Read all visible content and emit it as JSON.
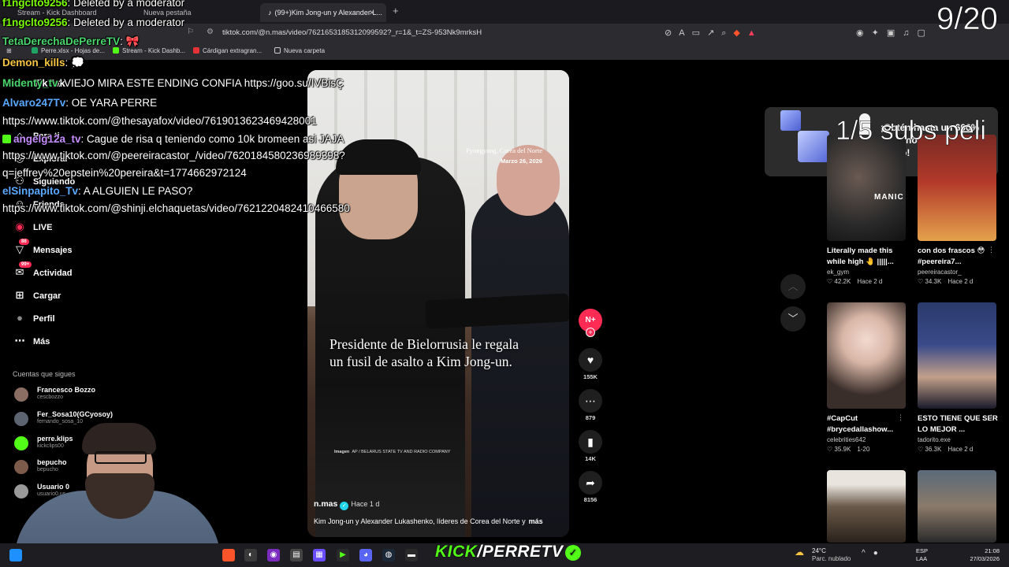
{
  "browser": {
    "tabs": [
      {
        "label": "Stream - Kick Dashboard"
      },
      {
        "label": "Nueva pestaña"
      },
      {
        "label": "(99+)Kim Jong-un y Alexander L..."
      }
    ],
    "url": "tiktok.com/@n.mas/video/7621653185312099592?_r=1&_t=ZS-953Nk9mrksH",
    "bookmarks": [
      {
        "label": "Perre.xlsx - Hojas de...",
        "color": "#1fa463"
      },
      {
        "label": "Stream - Kick Dashb...",
        "color": "#53fc18"
      },
      {
        "label": "Cárdigan extragran...",
        "color": "#e53238"
      },
      {
        "label": "Nueva carpeta",
        "color": "#cccccc"
      }
    ]
  },
  "overlays": {
    "counter": "9/20",
    "subs": "1/5 subs peli"
  },
  "chat": [
    {
      "user": "f1ngclto9256",
      "user_color": "#7cfc00",
      "text": ": Deleted by a moderator"
    },
    {
      "user": "f1ngclto9256",
      "user_color": "#7cfc00",
      "text": ": Deleted by a moderator"
    },
    {
      "user": "TetaDerechaDePerreTV",
      "user_color": "#4ad66d",
      "text": ": 🎀"
    },
    {
      "user": "Demon_kills",
      "user_color": "#f5c542",
      "text": ": 💭"
    },
    {
      "user": "Midenty_tv",
      "user_color": "#4ad66d",
      "text": ": VIEJO MIRA ESTE ENDING CONFIA https://goo.su/IVBisÇ"
    },
    {
      "user": "Alvaro247Tv",
      "user_color": "#5aa9ff",
      "text": ": OE YARA PERRE"
    },
    {
      "user": "",
      "user_color": "#ffffff",
      "text": "https://www.tiktok.com/@thesayafox/video/7619013623469428001"
    },
    {
      "user": "angelg12a_tv",
      "user_color": "#c58cff",
      "text": ": Cague de risa q teniendo como 10k bromeen asi JAJA"
    },
    {
      "user": "",
      "user_color": "#ffffff",
      "text": "https://www.tiktok.com/@peereiracastor_/video/7620184580236989398?"
    },
    {
      "user": "",
      "user_color": "#ffffff",
      "text": "q=jeffrey%20epstein%20pereira&t=1774662972124"
    },
    {
      "user": "elSinpapito_Tv",
      "user_color": "#5aa9ff",
      "text": ": A ALGUIEN LE PASO?"
    },
    {
      "user": "",
      "user_color": "#ffffff",
      "text": "https://www.tiktok.com/@shinji.elchaquetas/video/7621220482410466580"
    }
  ],
  "sidebar": {
    "items": [
      {
        "label": "TikTok",
        "icon": "tiktok-logo"
      },
      {
        "label": "Para ti",
        "icon": "home-icon"
      },
      {
        "label": "Explorar",
        "icon": "compass-icon"
      },
      {
        "label": "Siguiendo",
        "icon": "following-icon"
      },
      {
        "label": "Friends",
        "icon": "friends-icon"
      },
      {
        "label": "LIVE",
        "icon": "live-icon"
      },
      {
        "label": "Mensajes",
        "icon": "message-icon",
        "badge": "86"
      },
      {
        "label": "Actividad",
        "icon": "activity-icon",
        "badge": "99+"
      },
      {
        "label": "Cargar",
        "icon": "upload-icon"
      },
      {
        "label": "Perfil",
        "icon": "profile-icon"
      },
      {
        "label": "Más",
        "icon": "more-icon"
      }
    ],
    "following_heading": "Cuentas que sigues",
    "following": [
      {
        "name": "Francesco Bozzo",
        "handle": "cescbozzo",
        "color": "#8a6e64"
      },
      {
        "name": "Fer_Sosa10(GCyosoy)",
        "handle": "fernando_sosa_10",
        "color": "#5b6470"
      },
      {
        "name": "perre.klips",
        "handle": "kickclips00",
        "color": "#53fc18"
      },
      {
        "name": "bepucho",
        "handle": "bepucho",
        "color": "#7d5b4b"
      },
      {
        "name": "Usuario 0",
        "handle": "usuario0.us",
        "color": "#9a9a9a"
      }
    ],
    "see_more": "Ve"
  },
  "video": {
    "location": "Pyongyang, Corea del Norte",
    "date": "Marzo 26, 2026",
    "caption": "Presidente de Bielorrusia le regala un fusil de asalto a Kim Jong-un.",
    "credit_label": "Imagen",
    "credit": "AP / BELARUS STATE TV AND RADIO COMPANY",
    "author": "n.mas",
    "time": "Hace 1 d",
    "description": "Kim Jong-un y Alexander Lukashenko, líderes de Corea del Norte y",
    "more": "más"
  },
  "actions": {
    "avatar_label": "N+",
    "likes": "155K",
    "comments": "879",
    "saves": "14K",
    "shares": "8156"
  },
  "promo": {
    "text": "¡Obtén hasta un 600% de bono en tu depósito cripto!"
  },
  "recommended": [
    {
      "title": "Literally made this while high 🤚 |||||...",
      "author": "ek_gym",
      "likes": "42.2K",
      "age": "Hace 2 d",
      "thumb_label": "MANIC",
      "bg": "#2a2a2a"
    },
    {
      "title": "con dos frascos 😳 #peereira7...",
      "author": "peereiracastor_",
      "likes": "34.3K",
      "age": "Hace 2 d",
      "thumb_label": "",
      "bg": "#b33a2a"
    },
    {
      "title": "#CapCut #brycedallashow...",
      "author": "celebrities642",
      "likes": "35.9K",
      "age": "1-20",
      "thumb_label": "",
      "bg": "#c9b8ad"
    },
    {
      "title": "ESTO TIENE QUE SER LO MEJOR ...",
      "author": "tadorito.exe",
      "likes": "36.3K",
      "age": "Hace 2 d",
      "thumb_label": "",
      "bg": "#3a4a8a"
    },
    {
      "title": "",
      "author": "",
      "likes": "",
      "age": "",
      "thumb_label": "",
      "bg": "#e9e5de"
    },
    {
      "title": "",
      "author": "",
      "likes": "",
      "age": "",
      "thumb_label": "",
      "bg": "#5a6a7a"
    }
  ],
  "stream": {
    "brand_kick": "KICK",
    "brand_slash": "/",
    "brand_name": "PERRETV"
  },
  "taskbar": {
    "temp": "24°C",
    "weather": "Parc. nublado",
    "lang1": "ESP",
    "lang2": "LAA",
    "time": "21:08",
    "date": "27/03/2026"
  }
}
